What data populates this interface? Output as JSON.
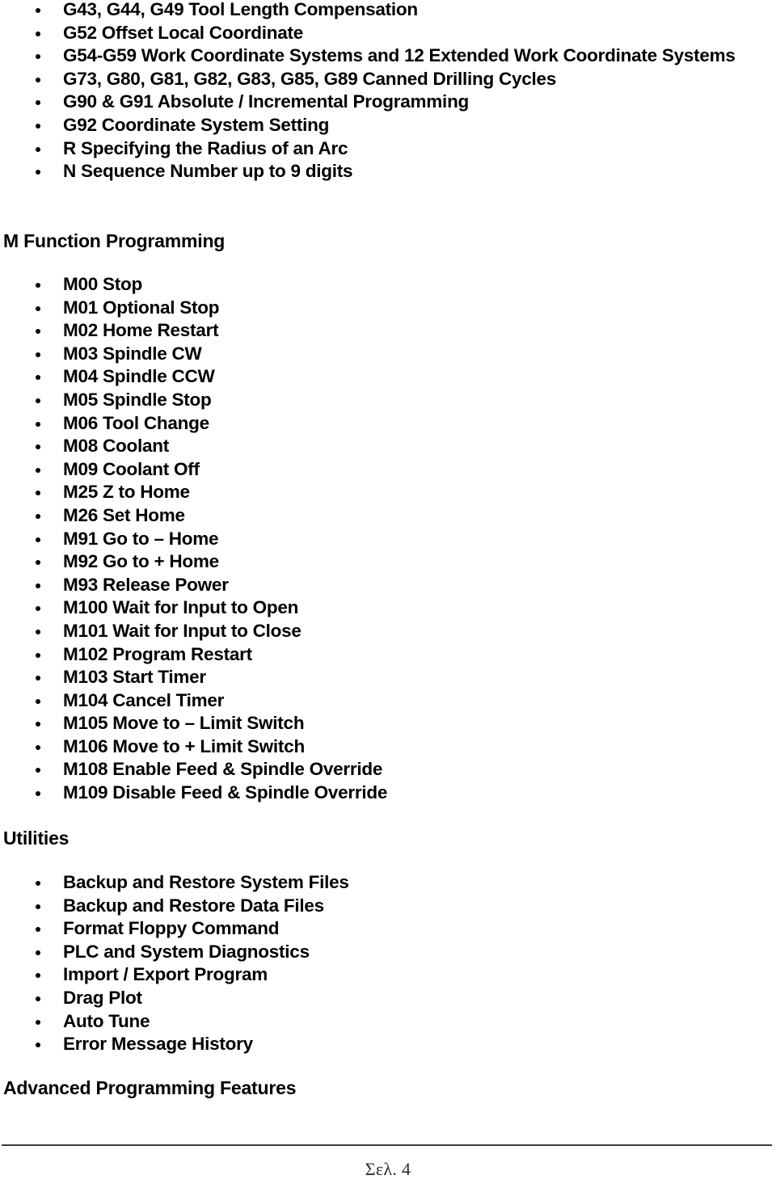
{
  "document": {
    "type": "cnc-control-feature-list",
    "page_label": "Σελ. 4"
  },
  "g_codes": {
    "items": [
      "G43, G44, G49 Tool Length Compensation",
      "G52 Offset Local Coordinate",
      "G54-G59 Work Coordinate Systems and 12 Extended Work Coordinate Systems",
      "G73, G80, G81, G82, G83, G85, G89 Canned Drilling Cycles",
      "G90 & G91 Absolute / Incremental Programming",
      "G92 Coordinate System Setting",
      "R Specifying the Radius of an Arc",
      "N Sequence Number up to 9 digits"
    ]
  },
  "m_functions": {
    "heading": "M Function Programming",
    "items": [
      "M00 Stop",
      "M01 Optional Stop",
      "M02 Home Restart",
      "M03 Spindle CW",
      "M04 Spindle CCW",
      "M05 Spindle Stop",
      "M06 Tool Change",
      "M08 Coolant",
      "M09 Coolant Off",
      "M25 Z to Home",
      "M26 Set Home",
      "M91 Go to – Home",
      "M92 Go to + Home",
      "M93 Release Power",
      "M100 Wait for Input to Open",
      "M101 Wait for Input to Close",
      "M102 Program Restart",
      "M103 Start Timer",
      "M104 Cancel Timer",
      "M105 Move to – Limit Switch",
      "M106 Move to + Limit Switch",
      "M108 Enable Feed & Spindle Override",
      "M109 Disable Feed & Spindle Override"
    ]
  },
  "utilities": {
    "heading": "Utilities",
    "items": [
      "Backup and Restore System Files",
      "Backup and Restore Data Files",
      "Format Floppy Command",
      "PLC and System Diagnostics",
      "Import / Export Program",
      "Drag Plot",
      "Auto Tune",
      "Error Message History"
    ]
  },
  "advanced": {
    "heading": "Advanced Programming Features"
  },
  "footer": {
    "page_text": "Σελ. 4"
  },
  "colors": {
    "text": "#000000",
    "background": "#ffffff",
    "rule": "#3a3a3a",
    "footer_text": "#2c2c2c"
  }
}
